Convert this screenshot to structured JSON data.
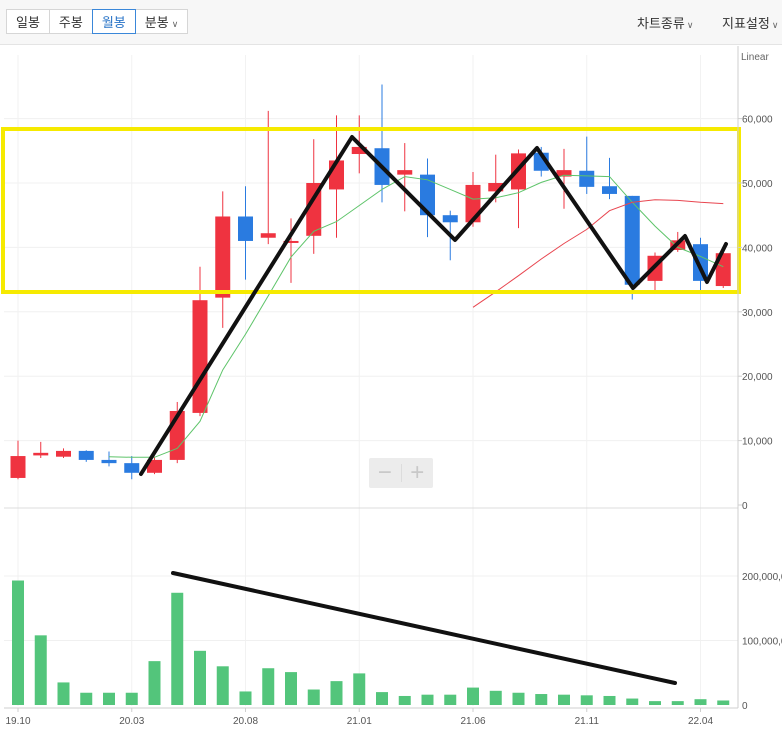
{
  "toolbar": {
    "tabs": [
      {
        "label": "일봉",
        "active": false
      },
      {
        "label": "주봉",
        "active": false
      },
      {
        "label": "월봉",
        "active": true
      },
      {
        "label": "분봉",
        "active": false
      }
    ],
    "chart_type_label": "차트종류",
    "indicator_label": "지표설정",
    "accent_color": "#2a74c7"
  },
  "zoom": {
    "minus": "−",
    "plus": "+"
  },
  "chart_data": {
    "type": "candlestick",
    "scale_label": "Linear",
    "up_color": "#ef3340",
    "down_color": "#2a7be0",
    "ma_colors": [
      "#5ec46a",
      "#e8454f"
    ],
    "price_axis": {
      "ylim": [
        0,
        65000
      ],
      "ticks": [
        "60,000",
        "50,000",
        "40,000",
        "30,000",
        "20,000",
        "10,000",
        "0"
      ]
    },
    "volume_axis": {
      "ylim": [
        0,
        240000000
      ],
      "ticks": [
        "200,000,0",
        "100,000,0",
        "0"
      ]
    },
    "x_tick_labels": [
      {
        "index": 0,
        "label": "19.10"
      },
      {
        "index": 5,
        "label": "20.03"
      },
      {
        "index": 10,
        "label": "20.08"
      },
      {
        "index": 15,
        "label": "21.01"
      },
      {
        "index": 20,
        "label": "21.06"
      },
      {
        "index": 25,
        "label": "21.11"
      },
      {
        "index": 30,
        "label": "22.04"
      }
    ],
    "candles": [
      {
        "o": 4200,
        "c": 7600,
        "h": 10000,
        "l": 4000
      },
      {
        "o": 7700,
        "c": 8100,
        "h": 9800,
        "l": 7300
      },
      {
        "o": 7500,
        "c": 8400,
        "h": 8800,
        "l": 7300
      },
      {
        "o": 8400,
        "c": 7000,
        "h": 8500,
        "l": 6700
      },
      {
        "o": 7000,
        "c": 6500,
        "h": 8300,
        "l": 6000
      },
      {
        "o": 6500,
        "c": 5000,
        "h": 7600,
        "l": 4000
      },
      {
        "o": 5000,
        "c": 7000,
        "h": 7500,
        "l": 4800
      },
      {
        "o": 7000,
        "c": 14600,
        "h": 16000,
        "l": 6500
      },
      {
        "o": 14300,
        "c": 31800,
        "h": 37000,
        "l": 13800
      },
      {
        "o": 32200,
        "c": 44800,
        "h": 48700,
        "l": 27500
      },
      {
        "o": 44800,
        "c": 41000,
        "h": 49500,
        "l": 35000
      },
      {
        "o": 41500,
        "c": 42200,
        "h": 61200,
        "l": 40500
      },
      {
        "o": 41000,
        "c": 41000,
        "h": 44500,
        "l": 34500
      },
      {
        "o": 41800,
        "c": 50000,
        "h": 56800,
        "l": 39000
      },
      {
        "o": 49000,
        "c": 53500,
        "h": 60500,
        "l": 41500
      },
      {
        "o": 54500,
        "c": 55600,
        "h": 60500,
        "l": 51500
      },
      {
        "o": 55400,
        "c": 49700,
        "h": 65300,
        "l": 47000
      },
      {
        "o": 51300,
        "c": 52000,
        "h": 56200,
        "l": 45600
      },
      {
        "o": 51300,
        "c": 45000,
        "h": 53800,
        "l": 41600
      },
      {
        "o": 45000,
        "c": 43900,
        "h": 45700,
        "l": 38000
      },
      {
        "o": 43900,
        "c": 49700,
        "h": 51700,
        "l": 43200
      },
      {
        "o": 48700,
        "c": 50000,
        "h": 54400,
        "l": 47000
      },
      {
        "o": 49000,
        "c": 54600,
        "h": 55200,
        "l": 43000
      },
      {
        "o": 54700,
        "c": 51900,
        "h": 55600,
        "l": 51000
      },
      {
        "o": 51000,
        "c": 52000,
        "h": 55300,
        "l": 46000
      },
      {
        "o": 51900,
        "c": 49400,
        "h": 57200,
        "l": 48300
      },
      {
        "o": 49500,
        "c": 48300,
        "h": 53900,
        "l": 47500
      },
      {
        "o": 48000,
        "c": 34200,
        "h": 48000,
        "l": 31900
      },
      {
        "o": 34800,
        "c": 38700,
        "h": 39200,
        "l": 33000
      },
      {
        "o": 39600,
        "c": 41100,
        "h": 42400,
        "l": 39300
      },
      {
        "o": 40500,
        "c": 34800,
        "h": 41500,
        "l": 33000
      },
      {
        "o": 34000,
        "c": 39100,
        "h": 39800,
        "l": 33700
      }
    ],
    "volume": [
      193000000,
      108000000,
      35000000,
      19000000,
      19000000,
      19000000,
      68000000,
      174000000,
      84000000,
      60000000,
      21000000,
      57000000,
      51000000,
      24000000,
      37000000,
      49000000,
      20000000,
      14000000,
      16000000,
      16000000,
      27000000,
      22000000,
      19000000,
      17000000,
      16000000,
      15000000,
      14000000,
      10000000,
      6000000,
      6000000,
      9000000,
      7000000
    ],
    "ma_short": [
      null,
      null,
      null,
      null,
      7500,
      7400,
      7400,
      8800,
      13000,
      21000,
      26500,
      32500,
      38500,
      42500,
      44000,
      46500,
      49000,
      51000,
      50500,
      49000,
      47500,
      47700,
      48500,
      50100,
      51200,
      51100,
      51000,
      47000,
      43300,
      40000,
      38600,
      37000
    ],
    "ma_long": [
      null,
      null,
      null,
      null,
      null,
      null,
      null,
      null,
      null,
      null,
      null,
      null,
      null,
      null,
      null,
      null,
      null,
      null,
      null,
      null,
      30700,
      33100,
      35600,
      38200,
      40600,
      42800,
      45700,
      47000,
      47400,
      47300,
      47000,
      46800
    ]
  }
}
